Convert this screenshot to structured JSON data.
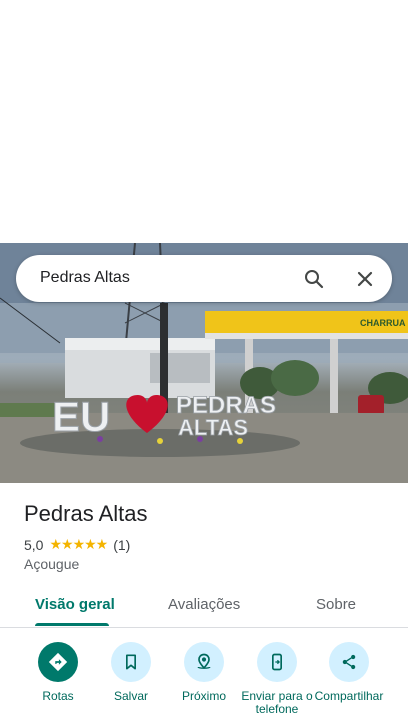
{
  "search": {
    "value": "Pedras Altas"
  },
  "hero_sign": {
    "left": "EU",
    "right_top": "PEDRAS",
    "right_bottom": "ALTAS",
    "station_brand": "CHARRUA"
  },
  "place": {
    "title": "Pedras Altas",
    "rating": "5,0",
    "stars": "★★★★★",
    "review_count": "(1)",
    "category": "Açougue"
  },
  "tabs": [
    {
      "label": "Visão geral"
    },
    {
      "label": "Avaliações"
    },
    {
      "label": "Sobre"
    }
  ],
  "actions": [
    {
      "label": "Rotas",
      "icon": "directions-icon"
    },
    {
      "label": "Salvar",
      "icon": "bookmark-icon"
    },
    {
      "label": "Próximo",
      "icon": "nearby-icon"
    },
    {
      "label": "Enviar para o telefone",
      "icon": "send-to-phone-icon"
    },
    {
      "label": "Compartilhar",
      "icon": "share-icon"
    }
  ],
  "colors": {
    "accent": "#00796b",
    "action_bg": "#d2f0ff",
    "star": "#f4b400"
  }
}
